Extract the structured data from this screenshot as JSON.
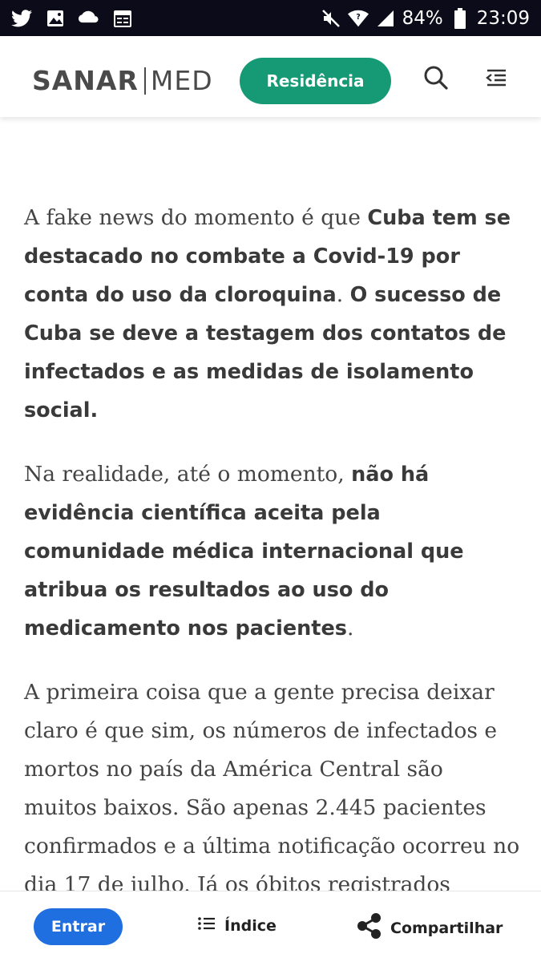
{
  "status_bar": {
    "battery": "84%",
    "time": "23:09",
    "icons": [
      "twitter-icon",
      "image-icon",
      "cloud-icon",
      "calendar-icon",
      "mute-icon",
      "wifi-icon",
      "signal-icon",
      "battery-icon"
    ]
  },
  "header": {
    "logo_bold": "SANAR",
    "logo_light": "MED",
    "residencia_label": "Residência",
    "accent_color": "#169a75",
    "icons": [
      "search-icon",
      "menu-collapse-icon"
    ]
  },
  "article": {
    "paragraphs": [
      {
        "segments": [
          {
            "style": "serif",
            "text": "A fake news do momento é que "
          },
          {
            "style": "bold",
            "text": "Cuba tem se destacado no combate a Covid-19 por conta do uso da cloroquina"
          },
          {
            "style": "serif",
            "text": ". "
          },
          {
            "style": "bold",
            "text": "O sucesso de Cuba se deve a testagem dos contatos de infectados e as medidas de isolamento social."
          }
        ]
      },
      {
        "segments": [
          {
            "style": "serif",
            "text": "Na realidade, até o momento, "
          },
          {
            "style": "bold",
            "text": "não há evidência científica aceita pela comunidade médica internacional que atribua os resultados ao uso do medicamento nos pacientes"
          },
          {
            "style": "serif",
            "text": "."
          }
        ]
      },
      {
        "segments": [
          {
            "style": "serif",
            "text": "A primeira coisa que a gente precisa deixar claro é que sim, os números de infectados e mortos no país da América Central são muitos baixos. São apenas 2.445 pacientes confirmados e a última notificação ocorreu no dia 17 de julho. Já os óbitos registrados"
          }
        ]
      }
    ]
  },
  "bottom_bar": {
    "entrar_label": "Entrar",
    "indice_label": "Índice",
    "compartilhar_label": "Compartilhar",
    "entrar_color": "#1f6fe0"
  }
}
